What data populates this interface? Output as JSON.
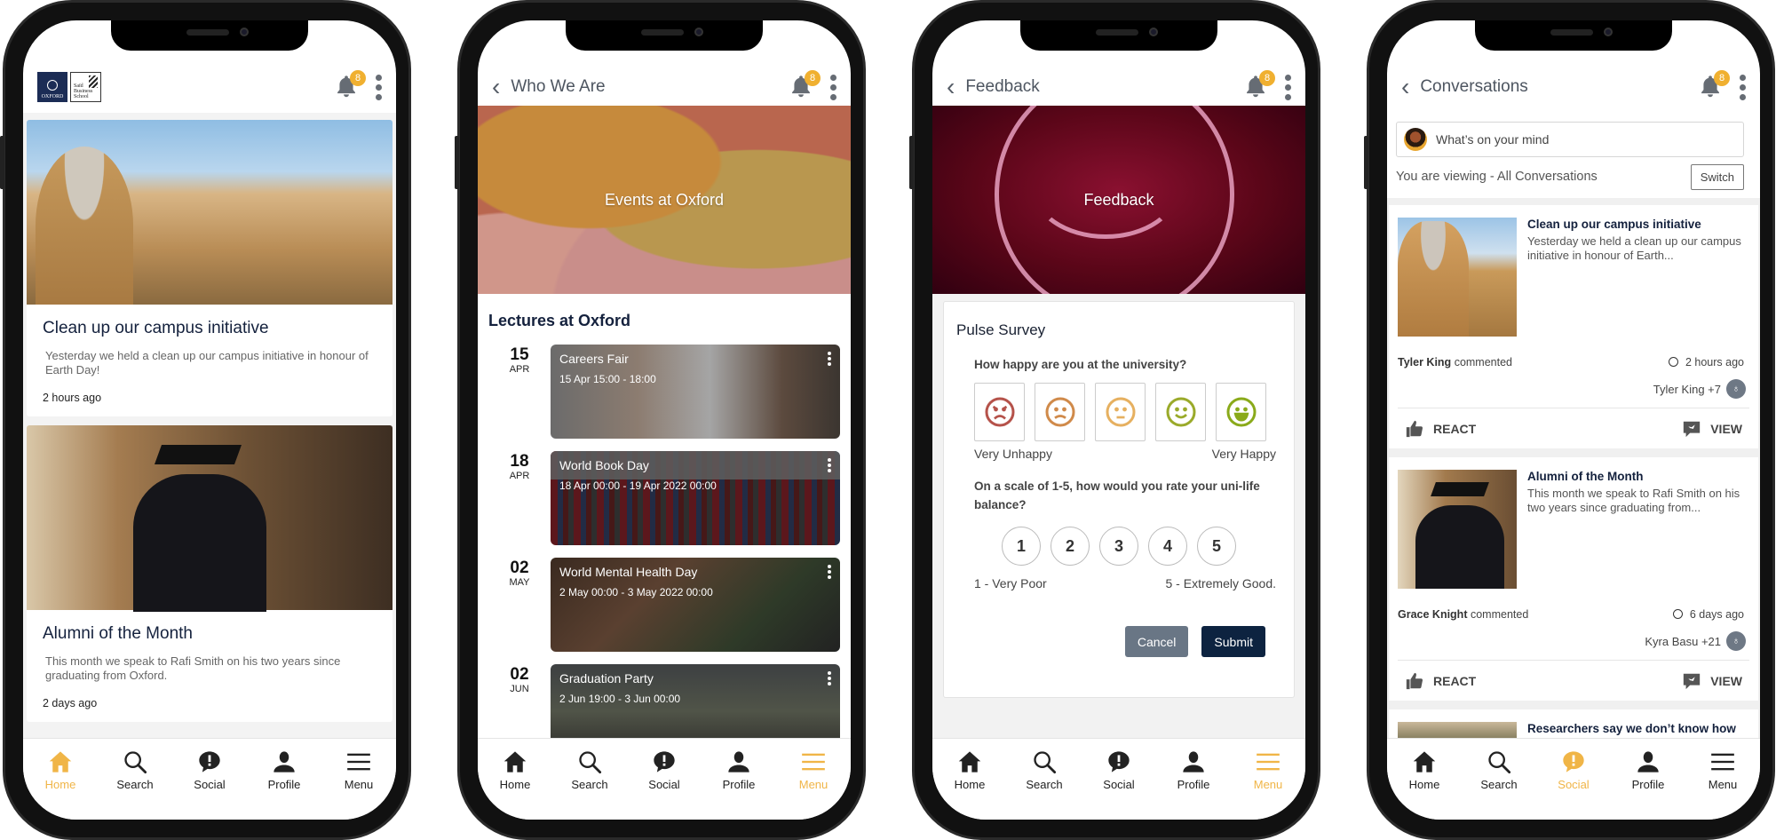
{
  "colors": {
    "accent": "#f0b547",
    "navy": "#14213d",
    "badge": "#f0b030",
    "submit": "#0d2340",
    "cancel": "#697685"
  },
  "notifications": {
    "count": "8"
  },
  "nav": {
    "items": [
      {
        "label": "Home",
        "icon": "home-icon"
      },
      {
        "label": "Search",
        "icon": "search-icon"
      },
      {
        "label": "Social",
        "icon": "social-bubble-icon"
      },
      {
        "label": "Profile",
        "icon": "profile-icon"
      },
      {
        "label": "Menu",
        "icon": "menu-icon"
      }
    ]
  },
  "home": {
    "logos": {
      "oxford_small": "UNIVERSITY OF",
      "oxford": "OXFORD",
      "sbs_line1": "Saïd",
      "sbs_line2": "Business",
      "sbs_line3": "School"
    },
    "active_nav": "Home",
    "cards": [
      {
        "title": "Clean up our campus initiative",
        "snippet": "Yesterday we held a clean up our campus initiative in honour of Earth Day!",
        "time": "2 hours ago"
      },
      {
        "title": "Alumni of the Month",
        "snippet": "This month we speak to Rafi Smith on his two years since graduating from Oxford.",
        "time": "2 days ago"
      }
    ]
  },
  "who_we_are": {
    "title": "Who We Are",
    "hero_title": "Events at Oxford",
    "section_title": "Lectures at Oxford",
    "active_nav": "Menu",
    "events": [
      {
        "day": "15",
        "month": "APR",
        "name": "Careers Fair",
        "when": "15 Apr 15:00 - 18:00"
      },
      {
        "day": "18",
        "month": "APR",
        "name": "World Book Day",
        "when": "18 Apr 00:00 - 19 Apr 2022 00:00"
      },
      {
        "day": "02",
        "month": "MAY",
        "name": "World Mental Health Day",
        "when": "2 May 00:00 - 3 May 2022 00:00"
      },
      {
        "day": "02",
        "month": "JUN",
        "name": "Graduation Party",
        "when": "2 Jun 19:00 - 3 Jun 00:00"
      }
    ]
  },
  "feedback": {
    "title": "Feedback",
    "hero_title": "Feedback",
    "active_nav": "Menu",
    "survey": {
      "title": "Pulse Survey",
      "q1": "How happy are you at the university?",
      "faces": [
        {
          "name": "very-unhappy",
          "color": "#b5524a"
        },
        {
          "name": "unhappy",
          "color": "#d08a4a"
        },
        {
          "name": "neutral",
          "color": "#e6b060"
        },
        {
          "name": "happy",
          "color": "#9aaa2a"
        },
        {
          "name": "very-happy",
          "color": "#8aaa1a"
        }
      ],
      "q1_low": "Very Unhappy",
      "q1_high": "Very Happy",
      "q2": "On a scale of 1-5, how would you rate your uni-life balance?",
      "scale": [
        "1",
        "2",
        "3",
        "4",
        "5"
      ],
      "q2_low": "1 - Very Poor",
      "q2_high": "5 - Extremely Good.",
      "cancel": "Cancel",
      "submit": "Submit"
    }
  },
  "conversations": {
    "title": "Conversations",
    "composer_placeholder": "What’s on your mind",
    "viewing": "You are viewing - All Conversations",
    "switch": "Switch",
    "active_nav": "Social",
    "react_label": "REACT",
    "view_label": "VIEW",
    "posts": [
      {
        "title": "Clean up our campus initiative",
        "snippet": "Yesterday we held a clean up our campus initiative in honour of Earth...",
        "author": "Tyler King",
        "action": "commented",
        "time": "2 hours ago",
        "reactors": "Tyler King +7"
      },
      {
        "title": "Alumni of the Month",
        "snippet": "This month we speak to Rafi Smith on his two years since graduating from...",
        "author": "Grace Knight",
        "action": "commented",
        "time": "6 days ago",
        "reactors": "Kyra Basu +21"
      },
      {
        "title": "Researchers say we don’t know how"
      }
    ]
  }
}
